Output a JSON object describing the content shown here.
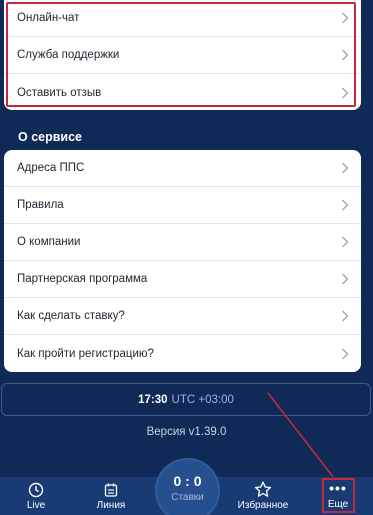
{
  "support_menu": [
    {
      "label": "Онлайн-чат"
    },
    {
      "label": "Служба поддержки"
    },
    {
      "label": "Оставить отзыв"
    }
  ],
  "about_section": {
    "title": "О сервисе",
    "items": [
      {
        "label": "Адреса ППС"
      },
      {
        "label": "Правила"
      },
      {
        "label": "О компании"
      },
      {
        "label": "Партнерская программа"
      },
      {
        "label": "Как сделать ставку?"
      },
      {
        "label": "Как пройти регистрацию?"
      }
    ]
  },
  "time_info": {
    "time": "17:30",
    "zone": "UTC +03:00"
  },
  "version": "Версия v1.39.0",
  "tabbar": {
    "live": "Live",
    "line": "Линия",
    "bets_score": "0 : 0",
    "bets": "Ставки",
    "favorites": "Избранное",
    "more_icon": "•••",
    "more": "Еще"
  },
  "colors": {
    "background": "#0f2a57",
    "tabbar": "#183b74",
    "annotation": "#c4283a"
  }
}
